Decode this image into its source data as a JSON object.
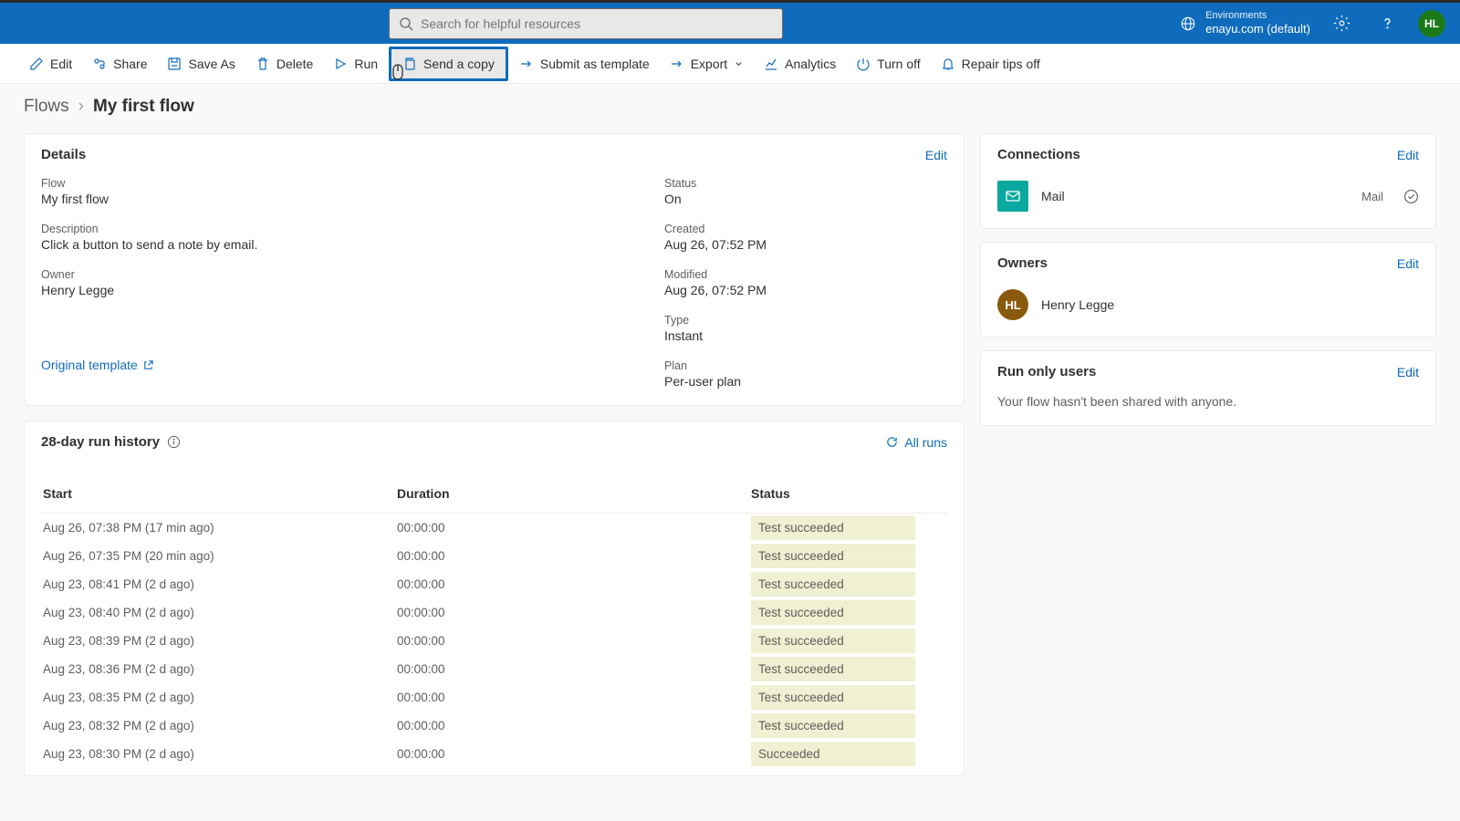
{
  "topbar": {
    "search_placeholder": "Search for helpful resources",
    "env_label": "Environments",
    "env_name": "enayu.com (default)",
    "avatar_initials": "HL"
  },
  "commands": {
    "edit": "Edit",
    "share": "Share",
    "saveas": "Save As",
    "delete": "Delete",
    "run": "Run",
    "sendcopy": "Send a copy",
    "submit": "Submit as template",
    "export": "Export",
    "analytics": "Analytics",
    "turnoff": "Turn off",
    "repair": "Repair tips off"
  },
  "breadcrumb": {
    "root": "Flows",
    "current": "My first flow"
  },
  "details": {
    "title": "Details",
    "edit": "Edit",
    "fields": {
      "flow_label": "Flow",
      "flow_value": "My first flow",
      "desc_label": "Description",
      "desc_value": "Click a button to send a note by email.",
      "owner_label": "Owner",
      "owner_value": "Henry Legge",
      "status_label": "Status",
      "status_value": "On",
      "created_label": "Created",
      "created_value": "Aug 26, 07:52 PM",
      "modified_label": "Modified",
      "modified_value": "Aug 26, 07:52 PM",
      "type_label": "Type",
      "type_value": "Instant",
      "plan_label": "Plan",
      "plan_value": "Per-user plan"
    },
    "original_link": "Original template"
  },
  "connections": {
    "title": "Connections",
    "edit": "Edit",
    "item_name": "Mail",
    "item_type": "Mail"
  },
  "owners": {
    "title": "Owners",
    "edit": "Edit",
    "owner_initials": "HL",
    "owner_name": "Henry Legge"
  },
  "runonly": {
    "title": "Run only users",
    "edit": "Edit",
    "text": "Your flow hasn't been shared with anyone."
  },
  "history": {
    "title": "28-day run history",
    "allruns": "All runs",
    "headers": {
      "start": "Start",
      "duration": "Duration",
      "status": "Status"
    },
    "rows": [
      {
        "start": "Aug 26, 07:38 PM (17 min ago)",
        "duration": "00:00:00",
        "status": "Test succeeded"
      },
      {
        "start": "Aug 26, 07:35 PM (20 min ago)",
        "duration": "00:00:00",
        "status": "Test succeeded"
      },
      {
        "start": "Aug 23, 08:41 PM (2 d ago)",
        "duration": "00:00:00",
        "status": "Test succeeded"
      },
      {
        "start": "Aug 23, 08:40 PM (2 d ago)",
        "duration": "00:00:00",
        "status": "Test succeeded"
      },
      {
        "start": "Aug 23, 08:39 PM (2 d ago)",
        "duration": "00:00:00",
        "status": "Test succeeded"
      },
      {
        "start": "Aug 23, 08:36 PM (2 d ago)",
        "duration": "00:00:00",
        "status": "Test succeeded"
      },
      {
        "start": "Aug 23, 08:35 PM (2 d ago)",
        "duration": "00:00:00",
        "status": "Test succeeded"
      },
      {
        "start": "Aug 23, 08:32 PM (2 d ago)",
        "duration": "00:00:00",
        "status": "Test succeeded"
      },
      {
        "start": "Aug 23, 08:30 PM (2 d ago)",
        "duration": "00:00:00",
        "status": "Succeeded"
      }
    ]
  }
}
